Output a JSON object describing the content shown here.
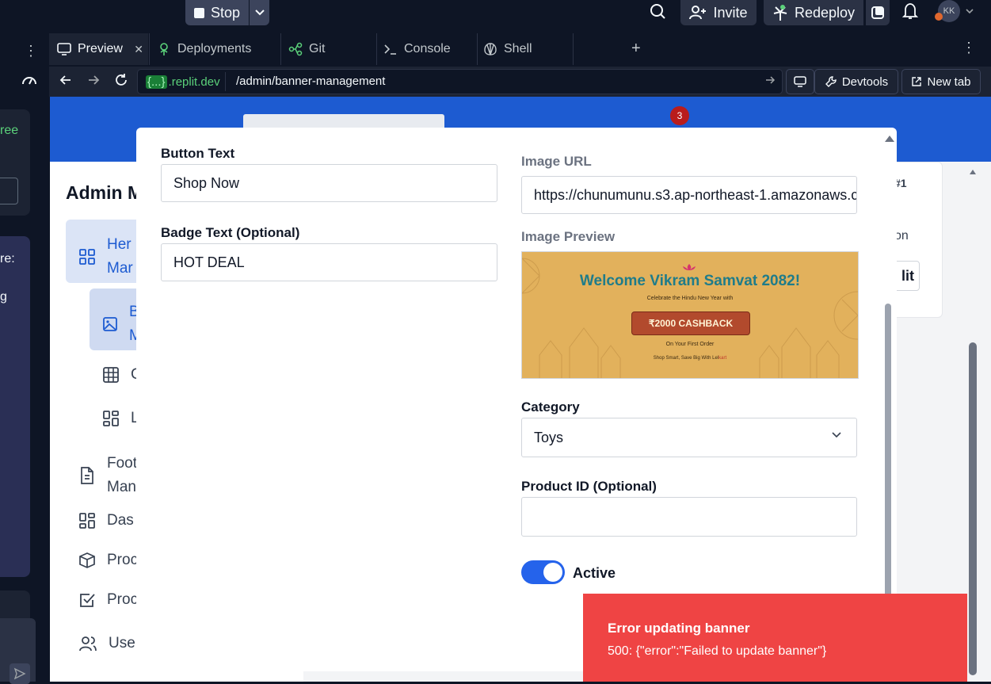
{
  "topbar": {
    "stop_label": "Stop",
    "invite_label": "Invite",
    "redeploy_label": "Redeploy",
    "avatar_initials": "KK"
  },
  "agent_panel": {
    "snippet_1": "ree",
    "snippet_2": "re:",
    "snippet_3": "g"
  },
  "tabs": [
    {
      "label": "Preview",
      "icon": "monitor-icon"
    },
    {
      "label": "Deployments",
      "icon": "deployments-icon"
    },
    {
      "label": "Git",
      "icon": "git-icon"
    },
    {
      "label": "Console",
      "icon": "terminal-icon"
    },
    {
      "label": "Shell",
      "icon": "shell-icon"
    }
  ],
  "urlbar": {
    "domain_badge": "{...}",
    "domain": ".replit.dev",
    "path": "/admin/banner-management",
    "devtools_label": "Devtools",
    "newtab_label": "New tab"
  },
  "webpage": {
    "cart_badge": "3",
    "sidebar_title": "Admin M",
    "items": {
      "hero": "Her",
      "hero2": "Mar",
      "banner": "B",
      "banner2": "M",
      "categories": "C",
      "sections": "L",
      "footer": "Foot",
      "footer2": "Man",
      "dashboard": "Das",
      "products": "Proc",
      "product_reviews": "Proc",
      "users": "Use"
    },
    "right_fragments": {
      "badge": "#1",
      "text": "on",
      "button": "lit"
    }
  },
  "modal": {
    "button_text": {
      "label": "Button Text",
      "value": "Shop Now"
    },
    "badge_text": {
      "label": "Badge Text (Optional)",
      "value": "HOT DEAL"
    },
    "image_url": {
      "label": "Image URL",
      "value": "https://chunumunu.s3.ap-northeast-1.amazonaws.c"
    },
    "image_preview": {
      "label": "Image Preview",
      "title": "Welcome Vikram Samvat 2082!",
      "subtitle": "Celebrate the Hindu New Year with",
      "cashback": "₹2000 CASHBACK",
      "order_line": "On Your First Order",
      "tagline": "Shop Smart, Save Big With Lel",
      "tagline_accent": "kart"
    },
    "category": {
      "label": "Category",
      "value": "Toys"
    },
    "product_id": {
      "label": "Product ID (Optional)",
      "value": ""
    },
    "active": {
      "label": "Active",
      "on": true
    }
  },
  "toast": {
    "title": "Error updating banner",
    "message": "500: {\"error\":\"Failed to update banner\"}"
  },
  "colors": {
    "ide_bg": "#0e1525",
    "brand_blue": "#1d5bd1",
    "toggle_on": "#2563eb",
    "error": "#ef4444",
    "replit_green": "#5bd17a"
  }
}
